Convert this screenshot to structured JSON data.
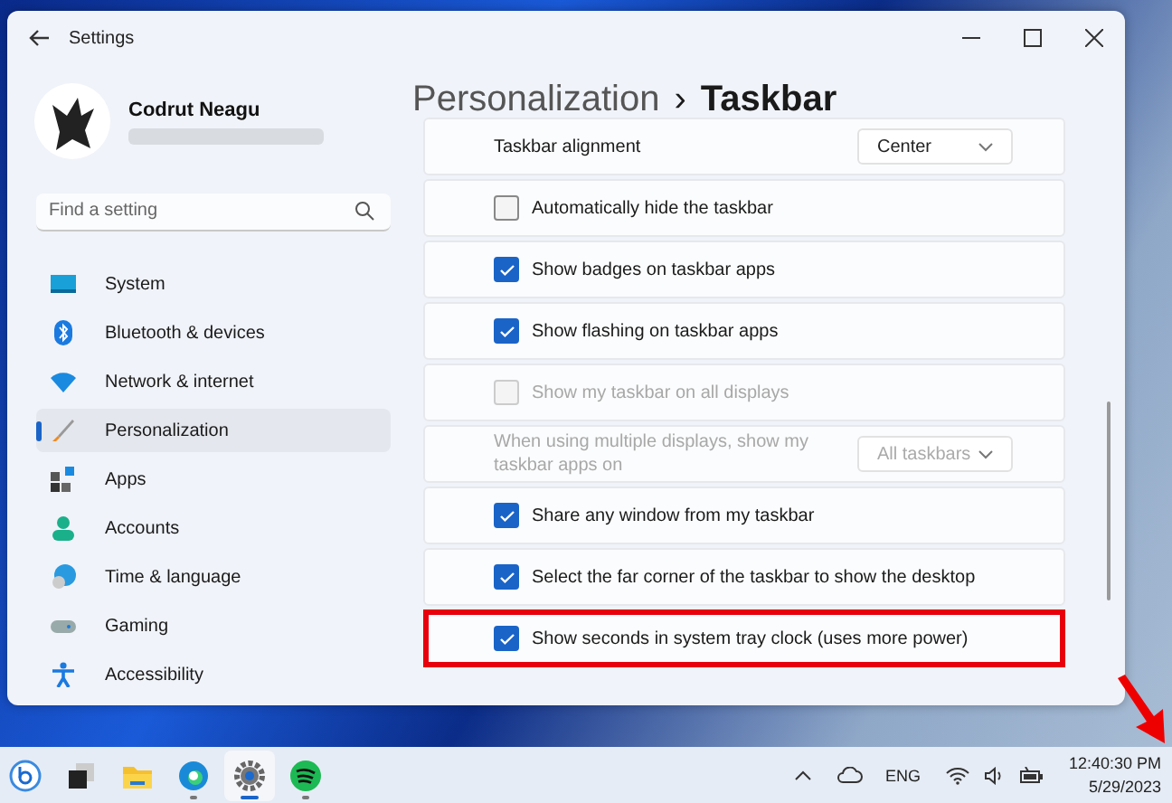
{
  "window": {
    "title": "Settings"
  },
  "profile": {
    "name": "Codrut Neagu"
  },
  "search": {
    "placeholder": "Find a setting"
  },
  "sidebar": {
    "items": [
      {
        "label": "System",
        "selected": false
      },
      {
        "label": "Bluetooth & devices",
        "selected": false
      },
      {
        "label": "Network & internet",
        "selected": false
      },
      {
        "label": "Personalization",
        "selected": true
      },
      {
        "label": "Apps",
        "selected": false
      },
      {
        "label": "Accounts",
        "selected": false
      },
      {
        "label": "Time & language",
        "selected": false
      },
      {
        "label": "Gaming",
        "selected": false
      },
      {
        "label": "Accessibility",
        "selected": false
      }
    ]
  },
  "breadcrumb": {
    "parent": "Personalization",
    "separator": "›",
    "current": "Taskbar"
  },
  "settings": [
    {
      "kind": "dropdown",
      "label": "Taskbar alignment",
      "value": "Center",
      "disabled": false,
      "highlighted": false
    },
    {
      "kind": "checkbox",
      "label": "Automatically hide the taskbar",
      "checked": false,
      "disabled": false,
      "highlighted": false
    },
    {
      "kind": "checkbox",
      "label": "Show badges on taskbar apps",
      "checked": true,
      "disabled": false,
      "highlighted": false
    },
    {
      "kind": "checkbox",
      "label": "Show flashing on taskbar apps",
      "checked": true,
      "disabled": false,
      "highlighted": false
    },
    {
      "kind": "checkbox",
      "label": "Show my taskbar on all displays",
      "checked": false,
      "disabled": true,
      "highlighted": false
    },
    {
      "kind": "dropdown",
      "label": "When using multiple displays, show my taskbar apps on",
      "value": "All taskbars",
      "disabled": true,
      "highlighted": false
    },
    {
      "kind": "checkbox",
      "label": "Share any window from my taskbar",
      "checked": true,
      "disabled": false,
      "highlighted": false
    },
    {
      "kind": "checkbox",
      "label": "Select the far corner of the taskbar to show the desktop",
      "checked": true,
      "disabled": false,
      "highlighted": false
    },
    {
      "kind": "checkbox",
      "label": "Show seconds in system tray clock (uses more power)",
      "checked": true,
      "disabled": false,
      "highlighted": true
    }
  ],
  "taskbar": {
    "apps": [
      {
        "selected": false,
        "running": false
      },
      {
        "selected": false,
        "running": false
      },
      {
        "selected": false,
        "running": false
      },
      {
        "selected": false,
        "running": true
      },
      {
        "selected": true,
        "running": true
      },
      {
        "selected": false,
        "running": true
      }
    ],
    "language": "ENG",
    "time": "12:40:30 PM",
    "date": "5/29/2023"
  }
}
